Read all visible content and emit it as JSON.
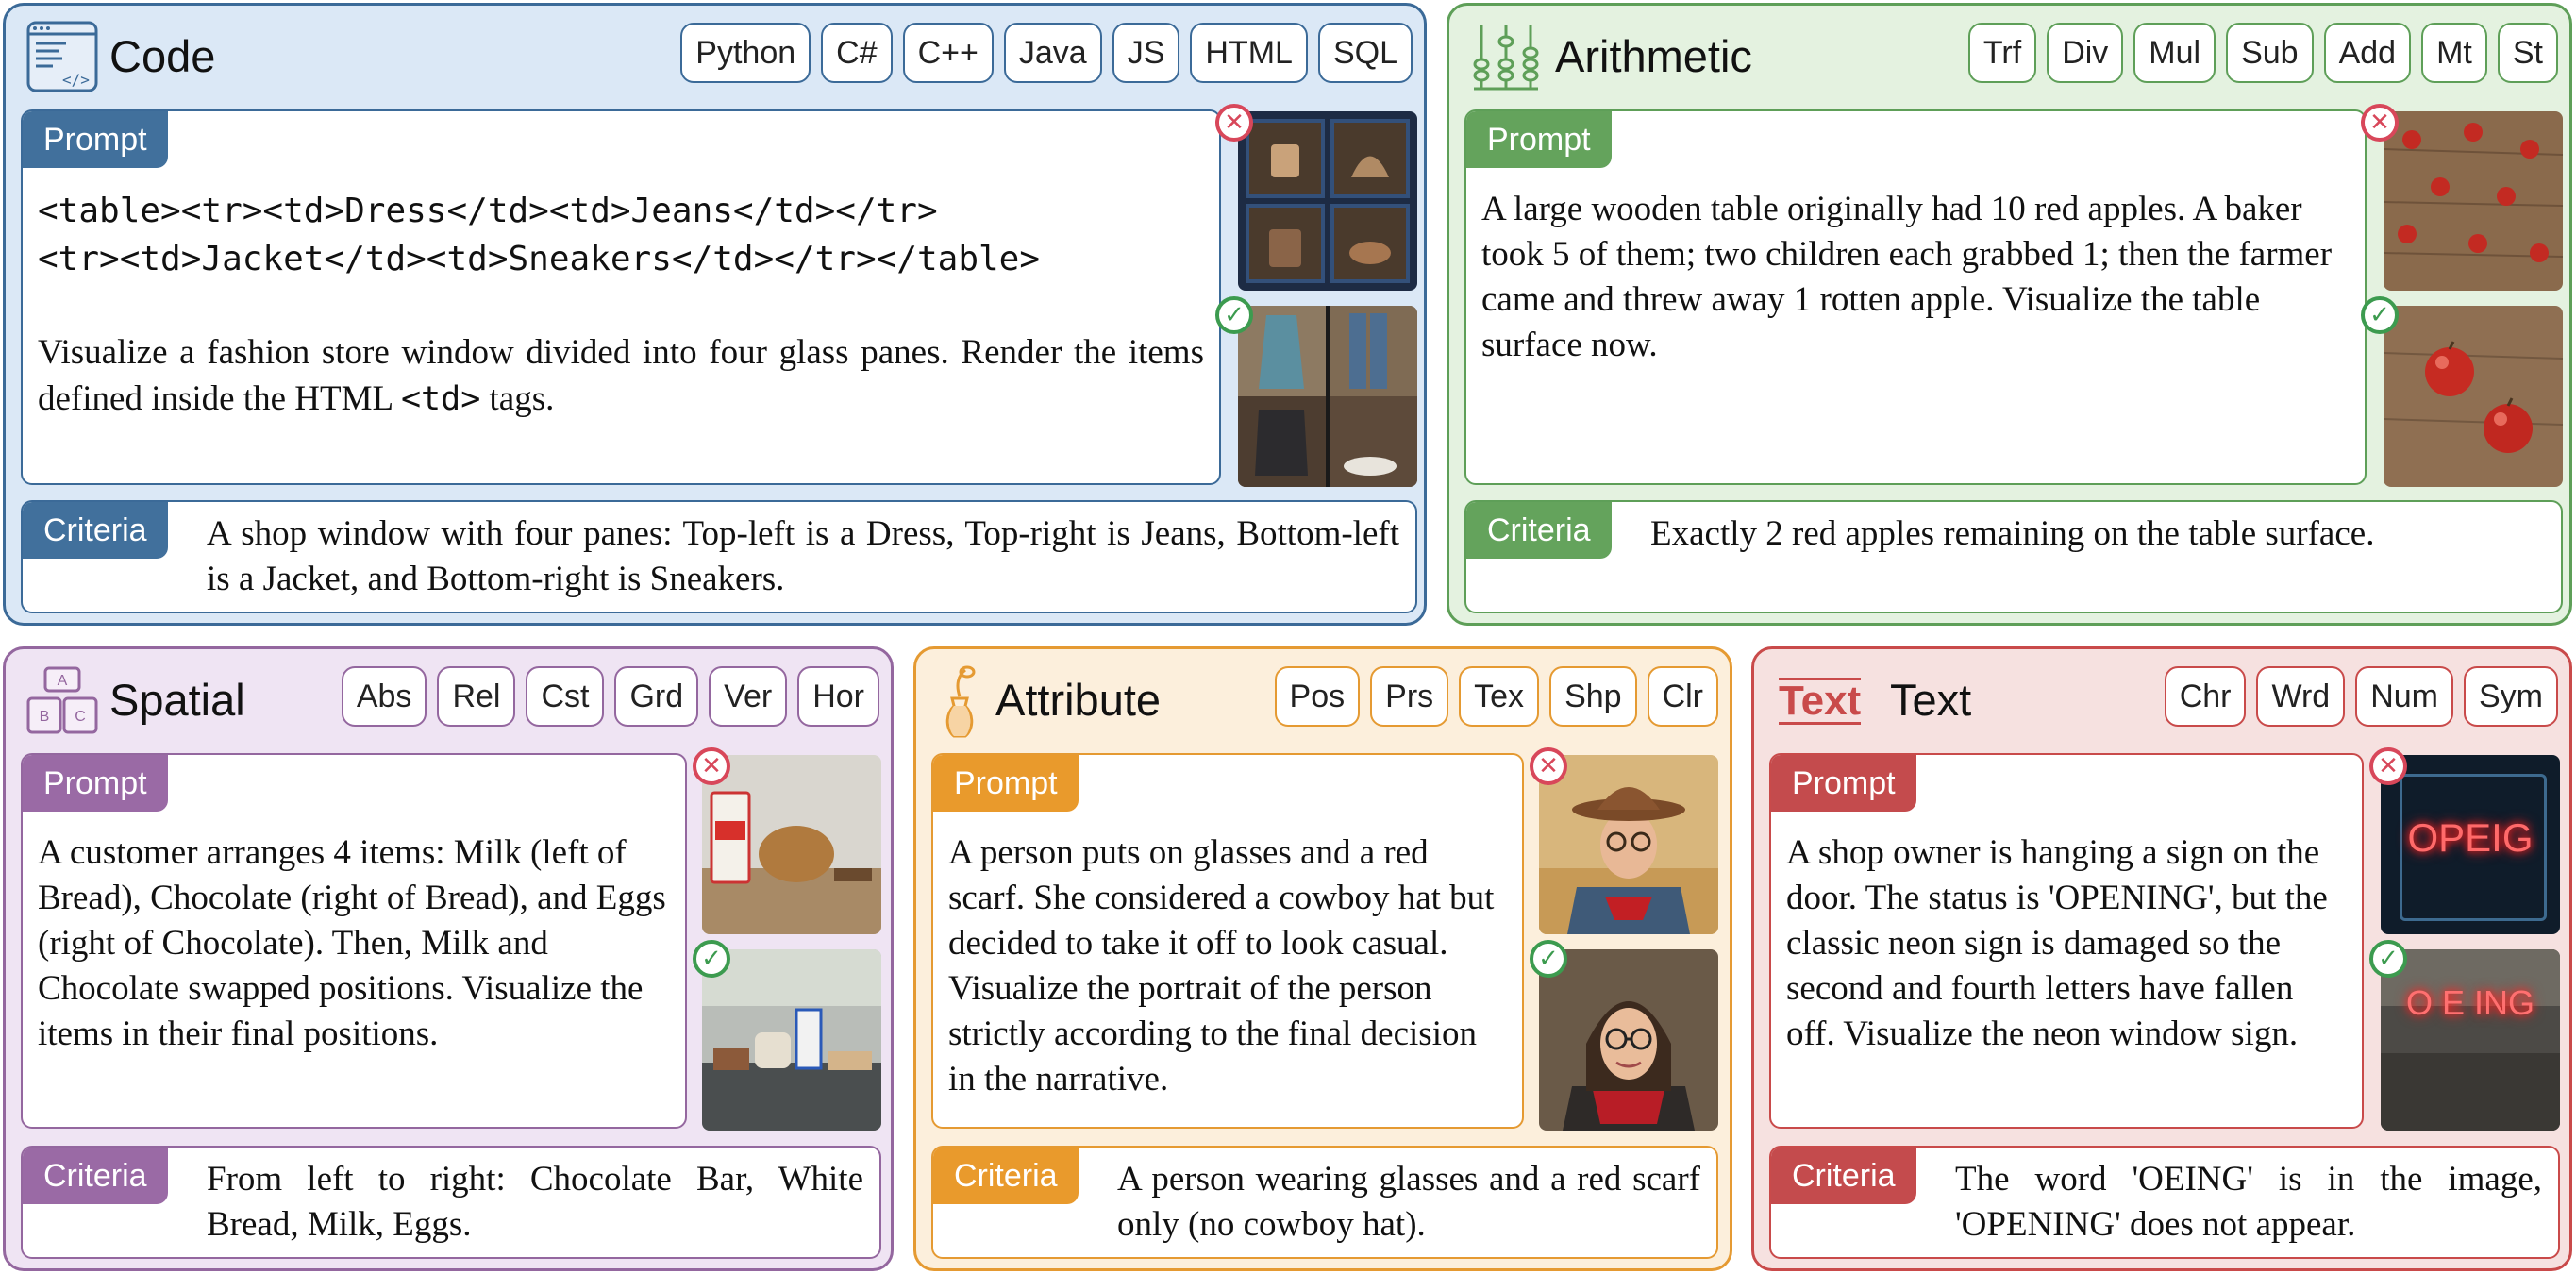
{
  "code": {
    "title": "Code",
    "tags": [
      "Python",
      "C#",
      "C++",
      "Java",
      "JS",
      "HTML",
      "SQL"
    ],
    "prompt_label": "Prompt",
    "prompt_code_line1": "<table><tr><td>Dress</td><td>Jeans</td></tr>",
    "prompt_code_line2": "<tr><td>Jacket</td><td>Sneakers</td></tr></table>",
    "prompt_text_1": "Visualize a fashion store window divided into four glass panes. Render the items defined inside the HTML ",
    "prompt_text_tag": "<td>",
    "prompt_text_2": " tags.",
    "criteria_label": "Criteria",
    "criteria_text": "A shop window with four panes: Top-left is a Dress, Top-right is Jeans, Bottom-left is a Jacket, and Bottom-right is Sneakers."
  },
  "arithmetic": {
    "title": "Arithmetic",
    "tags": [
      "Trf",
      "Div",
      "Mul",
      "Sub",
      "Add",
      "Mt",
      "St"
    ],
    "prompt_label": "Prompt",
    "prompt_text": "A large wooden table originally had 10 red apples. A baker took 5 of them; two children each grabbed 1; then the farmer came and threw away 1 rotten apple. Visualize the table surface now.",
    "criteria_label": "Criteria",
    "criteria_text": "Exactly 2 red apples remaining on the table surface."
  },
  "spatial": {
    "title": "Spatial",
    "icon_letters": [
      "A",
      "B",
      "C"
    ],
    "tags": [
      "Abs",
      "Rel",
      "Cst",
      "Grd",
      "Ver",
      "Hor"
    ],
    "prompt_label": "Prompt",
    "prompt_text": "A customer arranges 4 items: Milk (left of Bread), Chocolate (right of Bread), and Eggs (right of Chocolate). Then, Milk and Chocolate swapped positions. Visualize the items in their final positions.",
    "criteria_label": "Criteria",
    "criteria_text": "From left to right: Chocolate Bar, White Bread, Milk, Eggs."
  },
  "attribute": {
    "title": "Attribute",
    "tags": [
      "Pos",
      "Prs",
      "Tex",
      "Shp",
      "Clr"
    ],
    "prompt_label": "Prompt",
    "prompt_text": "A person puts on glasses and a red scarf. She considered a cowboy hat but decided to take it off to look casual. Visualize the portrait of the person strictly according to the final decision in the narrative.",
    "criteria_label": "Criteria",
    "criteria_text": "A person wearing glasses and a red scarf only (no cowboy hat)."
  },
  "text": {
    "title": "Text",
    "icon_text": "Text",
    "tags": [
      "Chr",
      "Wrd",
      "Num",
      "Sym"
    ],
    "prompt_label": "Prompt",
    "prompt_text": "A shop owner is hanging a sign on the door. The status is 'OPENING', but the classic neon sign is damaged so the second and fourth letters have fallen off. Visualize the neon window sign.",
    "criteria_label": "Criteria",
    "criteria_text": "The word 'OEING' is in the image, 'OPENING' does not appear.",
    "neon_bad": "OPEIG",
    "neon_good": "O E ING"
  },
  "marks": {
    "wrong": "✕",
    "right": "✓"
  },
  "colors": {
    "code": "#3b6a98",
    "arithmetic": "#5e9f58",
    "spatial": "#94679f",
    "attribute": "#e59a32",
    "text": "#c94a4a"
  }
}
